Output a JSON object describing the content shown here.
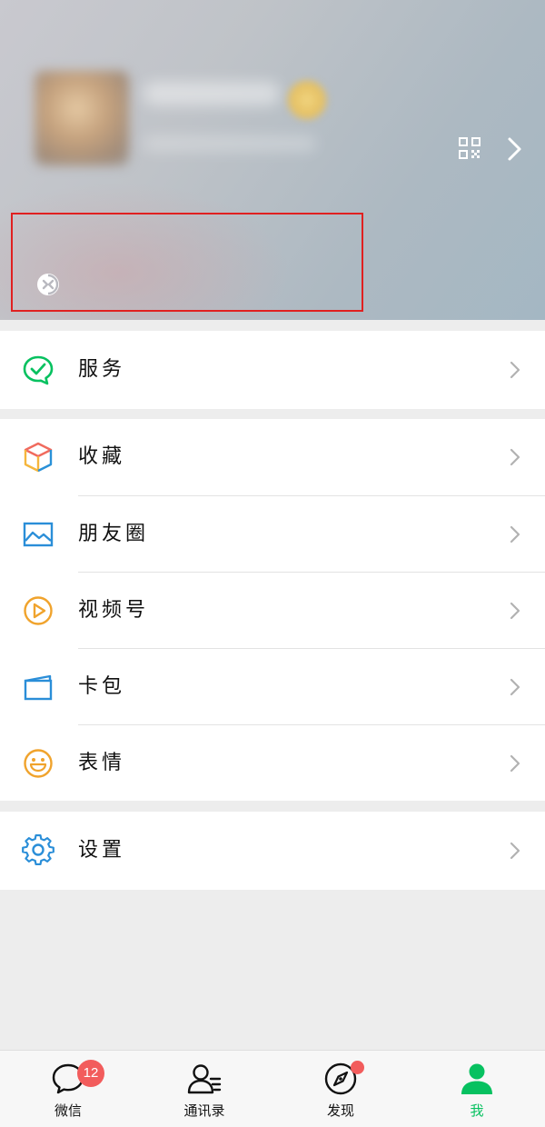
{
  "menu": {
    "services": {
      "label": "服务",
      "icon": "wechat-pay-icon"
    },
    "favorites": {
      "label": "收藏",
      "icon": "favorites-cube-icon"
    },
    "moments": {
      "label": "朋友圈",
      "icon": "moments-picture-icon"
    },
    "channels": {
      "label": "视频号",
      "icon": "channels-play-icon"
    },
    "cards": {
      "label": "卡包",
      "icon": "card-wallet-icon"
    },
    "stickers": {
      "label": "表情",
      "icon": "sticker-smile-icon"
    },
    "settings": {
      "label": "设置",
      "icon": "gear-icon"
    }
  },
  "tabbar": {
    "chats": {
      "label": "微信",
      "badge": "12"
    },
    "contacts": {
      "label": "通讯录"
    },
    "discover": {
      "label": "发现"
    },
    "me": {
      "label": "我"
    }
  },
  "colors": {
    "accent": "#07c160",
    "badge": "#f25c5c",
    "highlight_box": "#e02020"
  }
}
